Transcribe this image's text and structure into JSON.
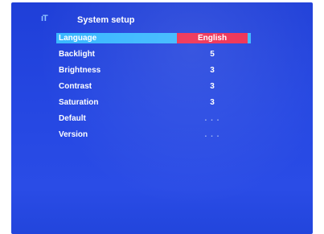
{
  "screen": {
    "mode_icon": "ıT",
    "title": "System setup"
  },
  "menu": {
    "items": [
      {
        "label": "Language",
        "value": "English"
      },
      {
        "label": "Backlight",
        "value": "5"
      },
      {
        "label": "Brightness",
        "value": "3"
      },
      {
        "label": "Contrast",
        "value": "3"
      },
      {
        "label": "Saturation",
        "value": "3"
      },
      {
        "label": "Default",
        "value": ". . ."
      },
      {
        "label": "Version",
        "value": ". . ."
      }
    ],
    "selected_index": 0
  },
  "colors": {
    "background": "#2547e2",
    "highlight_row": "#38b7ff",
    "highlight_value": "#ee2a4f",
    "text": "#ffffff"
  }
}
